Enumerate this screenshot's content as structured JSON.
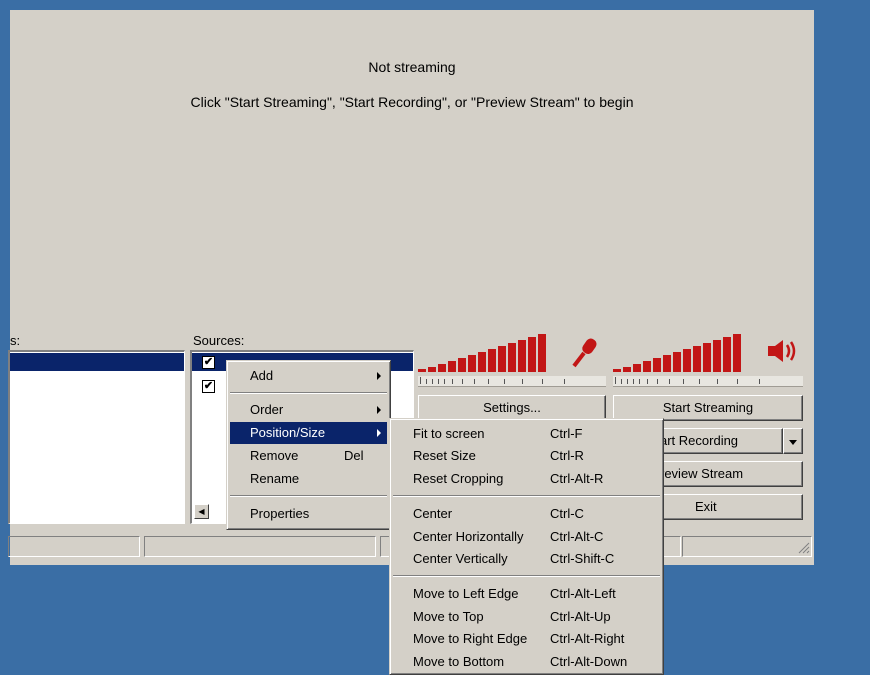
{
  "preview": {
    "status": "Not streaming",
    "hint": "Click \"Start Streaming\", \"Start Recording\", or \"Preview Stream\" to begin"
  },
  "scenes": {
    "label_fragment": "s:"
  },
  "sources": {
    "label": "Sources:"
  },
  "meters": {
    "mic_icon": "microphone-icon",
    "speaker_icon": "speaker-icon",
    "bar_color": "#c21616"
  },
  "buttons": {
    "settings": "Settings...",
    "start_streaming": "Start Streaming",
    "start_recording": "art Recording",
    "preview_stream": "review Stream",
    "exit": "Exit"
  },
  "context_menu": {
    "add": "Add",
    "order": "Order",
    "position_size": "Position/Size",
    "remove": "Remove",
    "remove_shortcut": "Del",
    "rename": "Rename",
    "properties": "Properties"
  },
  "submenu": {
    "fit": {
      "label": "Fit to screen",
      "shortcut": "Ctrl-F"
    },
    "reset_size": {
      "label": "Reset Size",
      "shortcut": "Ctrl-R"
    },
    "reset_crop": {
      "label": "Reset Cropping",
      "shortcut": "Ctrl-Alt-R"
    },
    "center": {
      "label": "Center",
      "shortcut": "Ctrl-C"
    },
    "center_h": {
      "label": "Center Horizontally",
      "shortcut": "Ctrl-Alt-C"
    },
    "center_v": {
      "label": "Center Vertically",
      "shortcut": "Ctrl-Shift-C"
    },
    "left": {
      "label": "Move to Left Edge",
      "shortcut": "Ctrl-Alt-Left"
    },
    "top": {
      "label": "Move to Top",
      "shortcut": "Ctrl-Alt-Up"
    },
    "right": {
      "label": "Move to Right Edge",
      "shortcut": "Ctrl-Alt-Right"
    },
    "bottom": {
      "label": "Move to Bottom",
      "shortcut": "Ctrl-Alt-Down"
    }
  },
  "colors": {
    "desktop": "#3a6ea5",
    "window": "#d4d0c8",
    "selection": "#0a246a"
  }
}
